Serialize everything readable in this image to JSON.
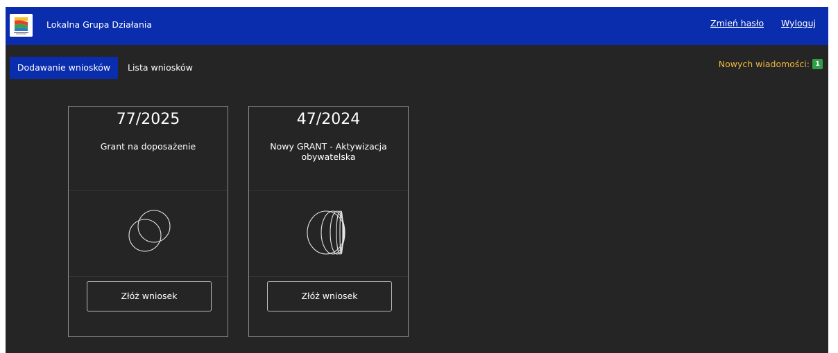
{
  "header": {
    "title": "Lokalna Grupa Działania",
    "logo_icon": "lgd-logo-icon",
    "links": {
      "change_password": "Zmień hasło",
      "logout": "Wyloguj"
    },
    "background_color": "#0a2dad"
  },
  "tabs": {
    "add_applications": "Dodawanie wniosków",
    "application_list": "Lista wniosków",
    "active": "Dodawanie wniosków"
  },
  "messages": {
    "label": "Nowych wiadomości:",
    "count": "1",
    "label_color": "#f0b83c",
    "badge_color": "#2f9e48"
  },
  "cards": [
    {
      "number": "77/2025",
      "name": "Grant na doposażenie",
      "icon": "two-circles-icon",
      "button_label": "Złóż wniosek"
    },
    {
      "number": "47/2024",
      "name": "Nowy GRANT - Aktywizacja obywatelska",
      "icon": "overlapping-ellipses-icon",
      "button_label": "Złóż wniosek"
    }
  ]
}
